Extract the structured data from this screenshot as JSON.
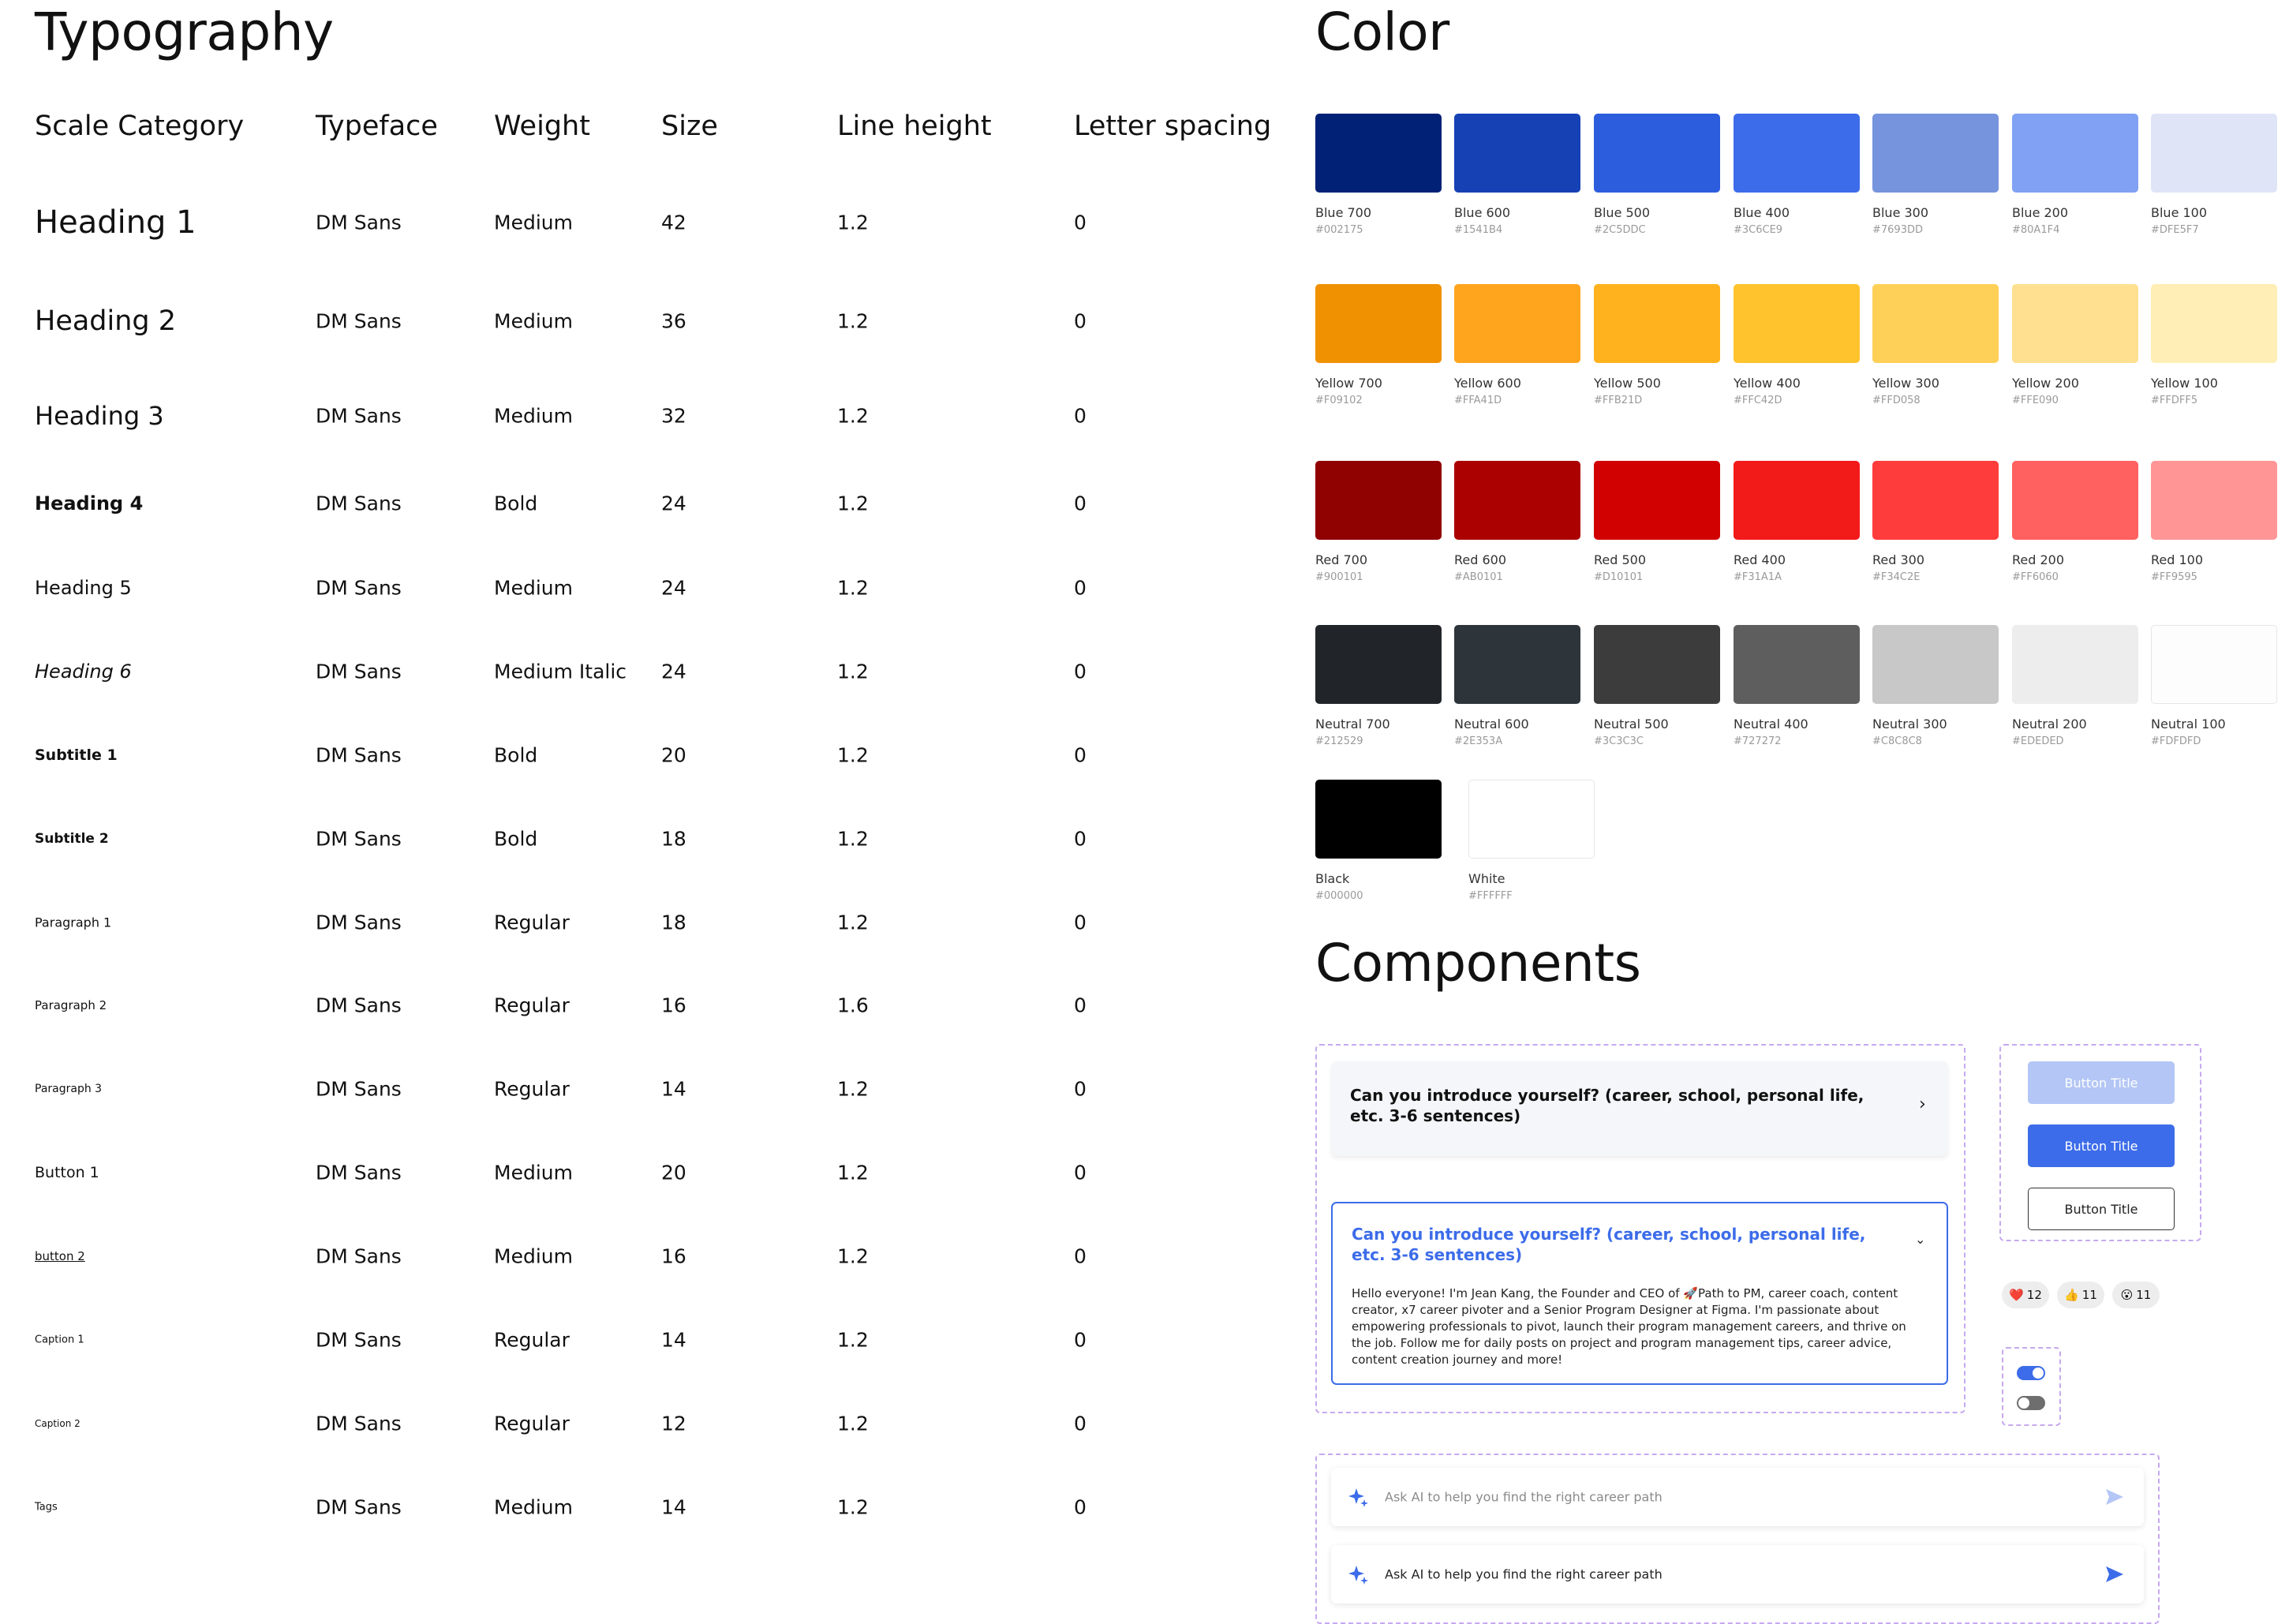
{
  "typography": {
    "title": "Typography",
    "headers": [
      "Scale Category",
      "Typeface",
      "Weight",
      "Size",
      "Line height",
      "Letter spacing"
    ],
    "rows": [
      {
        "category": "Heading 1",
        "typeface": "DM Sans",
        "weight": "Medium",
        "size": "42",
        "line_height": "1.2",
        "letter_spacing": "0"
      },
      {
        "category": "Heading 2",
        "typeface": "DM Sans",
        "weight": "Medium",
        "size": "36",
        "line_height": "1.2",
        "letter_spacing": "0"
      },
      {
        "category": "Heading 3",
        "typeface": "DM Sans",
        "weight": "Medium",
        "size": "32",
        "line_height": "1.2",
        "letter_spacing": "0"
      },
      {
        "category": "Heading 4",
        "typeface": "DM Sans",
        "weight": "Bold",
        "size": "24",
        "line_height": "1.2",
        "letter_spacing": "0"
      },
      {
        "category": "Heading 5",
        "typeface": "DM Sans",
        "weight": "Medium",
        "size": "24",
        "line_height": "1.2",
        "letter_spacing": "0"
      },
      {
        "category": "Heading 6",
        "typeface": "DM Sans",
        "weight": "Medium Italic",
        "size": "24",
        "line_height": "1.2",
        "letter_spacing": "0"
      },
      {
        "category": "Subtitle 1",
        "typeface": "DM Sans",
        "weight": "Bold",
        "size": "20",
        "line_height": "1.2",
        "letter_spacing": "0"
      },
      {
        "category": "Subtitle 2",
        "typeface": "DM Sans",
        "weight": "Bold",
        "size": "18",
        "line_height": "1.2",
        "letter_spacing": "0"
      },
      {
        "category": "Paragraph 1",
        "typeface": "DM Sans",
        "weight": "Regular",
        "size": "18",
        "line_height": "1.2",
        "letter_spacing": "0"
      },
      {
        "category": "Paragraph 2",
        "typeface": "DM Sans",
        "weight": "Regular",
        "size": "16",
        "line_height": "1.6",
        "letter_spacing": "0"
      },
      {
        "category": "Paragraph 3",
        "typeface": "DM Sans",
        "weight": "Regular",
        "size": "14",
        "line_height": "1.2",
        "letter_spacing": "0"
      },
      {
        "category": "Button 1",
        "typeface": "DM Sans",
        "weight": "Medium",
        "size": "20",
        "line_height": "1.2",
        "letter_spacing": "0"
      },
      {
        "category": "button 2",
        "typeface": "DM Sans",
        "weight": "Medium",
        "size": "16",
        "line_height": "1.2",
        "letter_spacing": "0"
      },
      {
        "category": "Caption 1",
        "typeface": "DM Sans",
        "weight": "Regular",
        "size": "14",
        "line_height": "1.2",
        "letter_spacing": "0"
      },
      {
        "category": "Caption 2",
        "typeface": "DM Sans",
        "weight": "Regular",
        "size": "12",
        "line_height": "1.2",
        "letter_spacing": "0"
      },
      {
        "category": "Tags",
        "typeface": "DM Sans",
        "weight": "Medium",
        "size": "14",
        "line_height": "1.2",
        "letter_spacing": "0"
      }
    ]
  },
  "color": {
    "title": "Color",
    "groups": [
      {
        "swatches": [
          {
            "name": "Blue 700",
            "hex": "#002175",
            "fill": "#002175"
          },
          {
            "name": "Blue 600",
            "hex": "#1541B4",
            "fill": "#1541B4"
          },
          {
            "name": "Blue 500",
            "hex": "#2C5DDC",
            "fill": "#2C5DDC"
          },
          {
            "name": "Blue 400",
            "hex": "#3C6CE9",
            "fill": "#3C6CE9"
          },
          {
            "name": "Blue 300",
            "hex": "#7693DD",
            "fill": "#7693DD"
          },
          {
            "name": "Blue 200",
            "hex": "#80A1F4",
            "fill": "#80A1F4"
          },
          {
            "name": "Blue 100",
            "hex": "#DFE5F7",
            "fill": "#DFE5F7"
          }
        ]
      },
      {
        "swatches": [
          {
            "name": "Yellow 700",
            "hex": "#F09102",
            "fill": "#F09102"
          },
          {
            "name": "Yellow 600",
            "hex": "#FFA41D",
            "fill": "#FFA41D"
          },
          {
            "name": "Yellow 500",
            "hex": "#FFB21D",
            "fill": "#FFB21D"
          },
          {
            "name": "Yellow 400",
            "hex": "#FFC42D",
            "fill": "#FFC42D"
          },
          {
            "name": "Yellow 300",
            "hex": "#FFD058",
            "fill": "#FFD058"
          },
          {
            "name": "Yellow 200",
            "hex": "#FFE090",
            "fill": "#FFE090"
          },
          {
            "name": "Yellow 100",
            "hex": "#FFDFF5",
            "fill": "#FFEEB5"
          }
        ]
      },
      {
        "swatches": [
          {
            "name": "Red 700",
            "hex": "#900101",
            "fill": "#900101"
          },
          {
            "name": "Red 600",
            "hex": "#AB0101",
            "fill": "#AB0101"
          },
          {
            "name": "Red 500",
            "hex": "#D10101",
            "fill": "#D10101"
          },
          {
            "name": "Red 400",
            "hex": "#F31A1A",
            "fill": "#F31A1A"
          },
          {
            "name": "Red 300",
            "hex": "#F34C2E",
            "fill": "#FF3C3C"
          },
          {
            "name": "Red 200",
            "hex": "#FF6060",
            "fill": "#FF6060"
          },
          {
            "name": "Red 100",
            "hex": "#FF9595",
            "fill": "#FF9595"
          }
        ]
      },
      {
        "swatches": [
          {
            "name": "Neutral 700",
            "hex": "#212529",
            "fill": "#212529"
          },
          {
            "name": "Neutral 600",
            "hex": "#2E353A",
            "fill": "#2E353A"
          },
          {
            "name": "Neutral 500",
            "hex": "#3C3C3C",
            "fill": "#3C3C3C"
          },
          {
            "name": "Neutral 400",
            "hex": "#727272",
            "fill": "#5E5E5E"
          },
          {
            "name": "Neutral 300",
            "hex": "#C8C8C8",
            "fill": "#C8C8C8"
          },
          {
            "name": "Neutral 200",
            "hex": "#EDEDED",
            "fill": "#EDEDED"
          },
          {
            "name": "Neutral 100",
            "hex": "#FDFDFD",
            "fill": "#FDFDFD"
          }
        ]
      },
      {
        "swatches": [
          {
            "name": "Black",
            "hex": "#000000",
            "fill": "#000000"
          },
          {
            "name": "White",
            "hex": "#FFFFFF",
            "fill": "#FFFFFF"
          }
        ]
      }
    ]
  },
  "components": {
    "title": "Components",
    "accordion_closed": {
      "question": "Can you introduce yourself? (career, school, personal life, etc. 3-6 sentences)"
    },
    "accordion_open": {
      "question": "Can you introduce yourself? (career, school, personal life, etc. 3-6 sentences)",
      "answer": "Hello everyone! I'm Jean Kang, the Founder and CEO of 🚀Path to PM, career coach, content creator, x7 career pivoter and a Senior Program Designer at Figma. I'm passionate about empowering professionals to pivot, launch their program management careers, and thrive on the job. Follow me for daily posts on project and program management tips, career advice, content creation journey and more!"
    },
    "buttons": [
      {
        "label": "Button Title",
        "state": "disabled"
      },
      {
        "label": "Button Title",
        "state": "primary"
      },
      {
        "label": "Button Title",
        "state": "secondary"
      }
    ],
    "reactions": [
      {
        "icon": "heart-icon",
        "glyph": "❤️",
        "count": "12"
      },
      {
        "icon": "thumbs-up-icon",
        "glyph": "👍",
        "count": "11"
      },
      {
        "icon": "surprised-face-icon",
        "glyph": "😮",
        "count": "11"
      }
    ],
    "toggles": [
      {
        "state": "on"
      },
      {
        "state": "off"
      }
    ],
    "ai_inputs": [
      {
        "placeholder": "Ask AI to help you find the right career path",
        "state": "inactive"
      },
      {
        "placeholder": "Ask AI to help you find the right career path",
        "state": "active"
      }
    ],
    "accent": "#3C6CE9"
  }
}
